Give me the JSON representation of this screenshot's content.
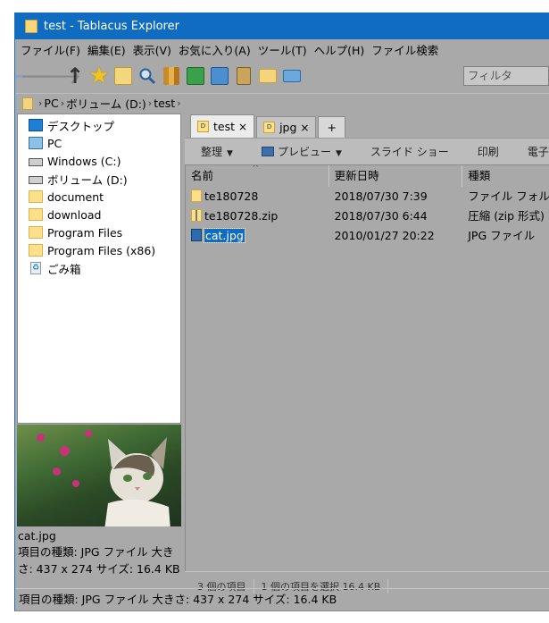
{
  "window": {
    "title": "test - Tablacus Explorer"
  },
  "menu": [
    "ファイル(F)",
    "編集(E)",
    "表示(V)",
    "お気に入り(A)",
    "ツール(T)",
    "ヘルプ(H)",
    "ファイル検索"
  ],
  "toolbar": {
    "filter_placeholder": "フィルタ"
  },
  "address": {
    "crumbs": [
      "PC",
      "ボリューム (D:)",
      "test"
    ]
  },
  "tree": {
    "items": [
      {
        "label": "デスクトップ",
        "icon": "desktop-icon"
      },
      {
        "label": "PC",
        "icon": "pc-icon"
      },
      {
        "label": "Windows (C:)",
        "icon": "windows-drive-icon"
      },
      {
        "label": "ボリューム (D:)",
        "icon": "drive-icon"
      },
      {
        "label": "document",
        "icon": "folder-icon"
      },
      {
        "label": "download",
        "icon": "folder-icon"
      },
      {
        "label": "Program Files",
        "icon": "folder-icon"
      },
      {
        "label": "Program Files (x86)",
        "icon": "folder-icon"
      },
      {
        "label": "ごみ箱",
        "icon": "recycle-bin-icon"
      }
    ]
  },
  "preview": {
    "filename": "cat.jpg",
    "info_line1": "項目の種類: JPG ファイル 大き",
    "info_line2": "さ: 437 x 274 サイズ: 16.4 KB"
  },
  "tabs": [
    {
      "label": "test",
      "close": "×",
      "icon_text": "D"
    },
    {
      "label": "jpg",
      "close": "×",
      "icon_text": "D"
    }
  ],
  "tab_add_label": "+",
  "commands": {
    "organize": "整理",
    "preview": "プレビュー",
    "slideshow": "スライド ショー",
    "print": "印刷",
    "email": "電子メール"
  },
  "columns": {
    "name": "名前",
    "date": "更新日時",
    "type": "種類"
  },
  "files": [
    {
      "name": "te180728",
      "date": "2018/07/30 7:39",
      "type": "ファイル フォルダー",
      "icon": "folder-icon"
    },
    {
      "name": "te180728.zip",
      "date": "2018/07/30 6:44",
      "type": "圧縮 (zip 形式) フォルダー",
      "icon": "zip-icon"
    },
    {
      "name": "cat.jpg",
      "date": "2010/01/27 20:22",
      "type": "JPG ファイル",
      "icon": "jpg-icon",
      "selected": true
    }
  ],
  "inner_status": {
    "count": "3 個の項目",
    "selected": "1 個の項目を選択  16.4 KB"
  },
  "statusbar": {
    "text": "項目の種類: JPG ファイル 大きさ: 437 x 274 サイズ: 16.4 KB"
  },
  "colors": {
    "titlebar": "#0f6cc1",
    "window_bg": "#a9a9a9",
    "selection": "#0f6cc1"
  }
}
